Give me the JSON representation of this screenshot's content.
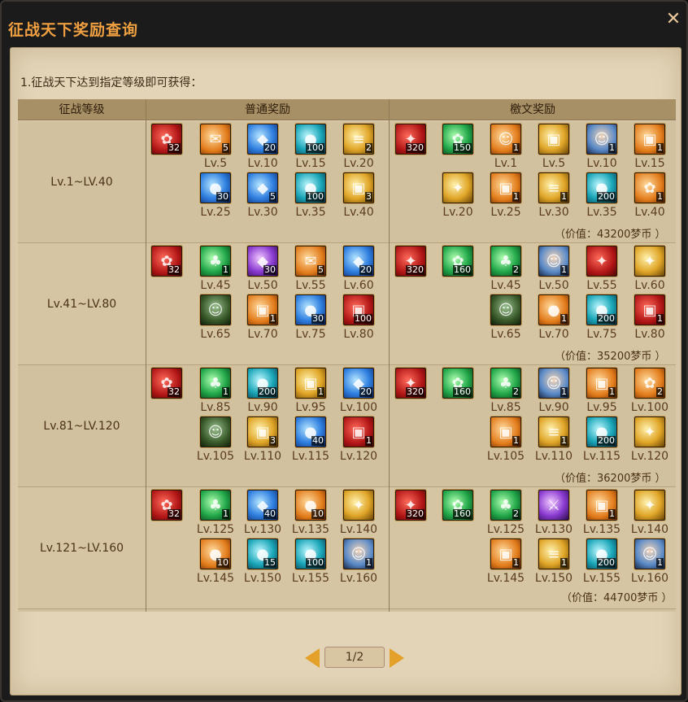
{
  "window": {
    "title": "征战天下奖励查询",
    "close_icon": "close-icon"
  },
  "subtitle": "1.征战天下达到指定等级即可获得：",
  "table": {
    "headers": {
      "level": "征战等级",
      "normal": "普通奖励",
      "weiwen": "檄文奖励"
    },
    "rows": [
      {
        "level": "Lv.1~LV.40",
        "normal": [
          {
            "icon": "red-pouch-icon",
            "count": "32",
            "level": ""
          },
          {
            "icon": "scroll-icon",
            "count": "5",
            "level": "Lv.5"
          },
          {
            "icon": "blue-crystal-icon",
            "count": "20",
            "level": "Lv.10"
          },
          {
            "icon": "teal-orb-icon",
            "count": "100",
            "level": "Lv.15"
          },
          {
            "icon": "book-icon",
            "count": "2",
            "level": "Lv.20"
          },
          {
            "icon": "blue-orb-icon",
            "count": "30",
            "level": "Lv.25"
          },
          {
            "icon": "ice-crystal-icon",
            "count": "5",
            "level": "Lv.30"
          },
          {
            "icon": "teal-orb-icon",
            "count": "100",
            "level": "Lv.35"
          },
          {
            "icon": "gold-box-icon",
            "count": "3",
            "level": "Lv.40"
          }
        ],
        "weiwen": [
          {
            "icon": "red-badge-icon",
            "count": "320",
            "level": ""
          },
          {
            "icon": "green-gem-icon",
            "count": "150",
            "level": ""
          },
          {
            "icon": "armor-icon",
            "count": "1",
            "level": "Lv.1"
          },
          {
            "icon": "gift-box-icon",
            "count": "",
            "level": "Lv.5"
          },
          {
            "icon": "hero-portrait-icon",
            "count": "1",
            "level": "Lv.10"
          },
          {
            "icon": "treasure-chest-icon",
            "count": "1",
            "level": "Lv.15"
          },
          {
            "icon": "gold-emblem-icon",
            "count": "",
            "level": "Lv.20"
          },
          {
            "icon": "treasure-chest-icon",
            "count": "1",
            "level": "Lv.25"
          },
          {
            "icon": "book-icon",
            "count": "1",
            "level": "Lv.30"
          },
          {
            "icon": "teal-orb-icon",
            "count": "200",
            "level": "Lv.35"
          },
          {
            "icon": "gold-pouch-icon",
            "count": "1",
            "level": "Lv.40"
          }
        ],
        "value": "（价值：43200梦币 ）"
      },
      {
        "level": "Lv.41~LV.80",
        "normal": [
          {
            "icon": "red-pouch-icon",
            "count": "32",
            "level": ""
          },
          {
            "icon": "clover-icon",
            "count": "1",
            "level": "Lv.45"
          },
          {
            "icon": "purple-crystal-icon",
            "count": "30",
            "level": "Lv.50"
          },
          {
            "icon": "scroll-icon",
            "count": "5",
            "level": "Lv.55"
          },
          {
            "icon": "blue-crystal-icon",
            "count": "20",
            "level": "Lv.60"
          },
          {
            "icon": "character-icon",
            "count": "",
            "level": "Lv.65"
          },
          {
            "icon": "treasure-chest-icon",
            "count": "1",
            "level": "Lv.70"
          },
          {
            "icon": "blue-orb-icon",
            "count": "30",
            "level": "Lv.75"
          },
          {
            "icon": "red-chest-icon",
            "count": "100",
            "level": "Lv.80"
          }
        ],
        "weiwen": [
          {
            "icon": "red-badge-icon",
            "count": "320",
            "level": ""
          },
          {
            "icon": "green-gem-icon",
            "count": "160",
            "level": ""
          },
          {
            "icon": "clover-icon",
            "count": "2",
            "level": "Lv.45"
          },
          {
            "icon": "hero-portrait-icon",
            "count": "1",
            "level": "Lv.50"
          },
          {
            "icon": "red-emblem-icon",
            "count": "",
            "level": "Lv.55"
          },
          {
            "icon": "gold-emblem-icon",
            "count": "",
            "level": "Lv.60"
          },
          {
            "icon": "character-icon",
            "count": "",
            "level": "Lv.65"
          },
          {
            "icon": "egg-icon",
            "count": "1",
            "level": "Lv.70"
          },
          {
            "icon": "teal-orb-icon",
            "count": "200",
            "level": "Lv.75"
          },
          {
            "icon": "red-chest-icon",
            "count": "1",
            "level": "Lv.80"
          }
        ],
        "value": "（价值：35200梦币 ）"
      },
      {
        "level": "Lv.81~LV.120",
        "normal": [
          {
            "icon": "red-pouch-icon",
            "count": "32",
            "level": ""
          },
          {
            "icon": "clover-icon",
            "count": "1",
            "level": "Lv.85"
          },
          {
            "icon": "teal-orb-icon",
            "count": "200",
            "level": "Lv.90"
          },
          {
            "icon": "gold-box-icon",
            "count": "1",
            "level": "Lv.95"
          },
          {
            "icon": "blue-crystal-icon",
            "count": "20",
            "level": "Lv.100"
          },
          {
            "icon": "character-icon",
            "count": "",
            "level": "Lv.105"
          },
          {
            "icon": "gold-box-icon",
            "count": "3",
            "level": "Lv.110"
          },
          {
            "icon": "blue-orb-icon",
            "count": "40",
            "level": "Lv.115"
          },
          {
            "icon": "red-chest-icon",
            "count": "1",
            "level": "Lv.120"
          }
        ],
        "weiwen": [
          {
            "icon": "red-badge-icon",
            "count": "320",
            "level": ""
          },
          {
            "icon": "green-gem-icon",
            "count": "160",
            "level": ""
          },
          {
            "icon": "clover-icon",
            "count": "2",
            "level": "Lv.85"
          },
          {
            "icon": "hero-portrait-icon",
            "count": "1",
            "level": "Lv.90"
          },
          {
            "icon": "treasure-chest-icon",
            "count": "1",
            "level": "Lv.95"
          },
          {
            "icon": "gift-bag-icon",
            "count": "2",
            "level": "Lv.100"
          },
          {
            "icon": "treasure-chest-icon",
            "count": "1",
            "level": "Lv.105"
          },
          {
            "icon": "book-icon",
            "count": "1",
            "level": "Lv.110"
          },
          {
            "icon": "teal-orb-icon",
            "count": "200",
            "level": "Lv.115"
          },
          {
            "icon": "gold-emblem-icon",
            "count": "",
            "level": "Lv.120"
          }
        ],
        "value": "（价值：36200梦币 ）"
      },
      {
        "level": "Lv.121~LV.160",
        "normal": [
          {
            "icon": "red-pouch-icon",
            "count": "32",
            "level": ""
          },
          {
            "icon": "clover-icon",
            "count": "1",
            "level": "Lv.125"
          },
          {
            "icon": "blue-crystal-icon",
            "count": "40",
            "level": "Lv.130"
          },
          {
            "icon": "fire-orb-icon",
            "count": "10",
            "level": "Lv.135"
          },
          {
            "icon": "gold-emblem-icon",
            "count": "",
            "level": "Lv.140"
          },
          {
            "icon": "fire-orb-icon",
            "count": "10",
            "level": "Lv.145"
          },
          {
            "icon": "green-orb-icon",
            "count": "15",
            "level": "Lv.150"
          },
          {
            "icon": "teal-orb-icon",
            "count": "100",
            "level": "Lv.155"
          },
          {
            "icon": "warrior-portrait-icon",
            "count": "1",
            "level": "Lv.160"
          }
        ],
        "weiwen": [
          {
            "icon": "red-badge-icon",
            "count": "320",
            "level": ""
          },
          {
            "icon": "green-gem-icon",
            "count": "160",
            "level": ""
          },
          {
            "icon": "clover-icon",
            "count": "2",
            "level": "Lv.125"
          },
          {
            "icon": "sword-icon",
            "count": "",
            "level": "Lv.130"
          },
          {
            "icon": "treasure-chest-icon",
            "count": "1",
            "level": "Lv.135"
          },
          {
            "icon": "gold-emblem-icon",
            "count": "",
            "level": "Lv.140"
          },
          {
            "icon": "treasure-chest-icon",
            "count": "1",
            "level": "Lv.145"
          },
          {
            "icon": "book-icon",
            "count": "1",
            "level": "Lv.150"
          },
          {
            "icon": "teal-orb-icon",
            "count": "200",
            "level": "Lv.155"
          },
          {
            "icon": "hero-portrait-icon",
            "count": "1",
            "level": "Lv.160"
          }
        ],
        "value": "（价值：44700梦币 ）"
      }
    ]
  },
  "pager": {
    "page": "1/2",
    "prev_icon": "prev-arrow-icon",
    "next_icon": "next-arrow-icon"
  }
}
